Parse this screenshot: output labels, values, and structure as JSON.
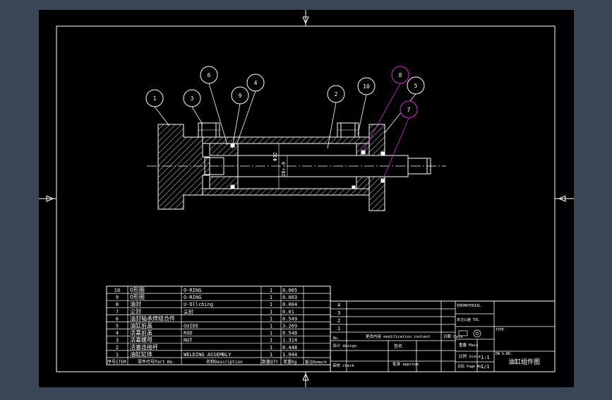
{
  "colors": {
    "background": "#3a4656",
    "sheet": "#000000",
    "line": "#ffffff",
    "balloon_highlight": "#cc33cc"
  },
  "balloons": [
    "1",
    "3",
    "6",
    "9",
    "4",
    "2",
    "10",
    "8",
    "5",
    "7"
  ],
  "dims": {
    "d1": "Φ32",
    "d2": "20↑.0"
  },
  "bom": {
    "rows": [
      {
        "no": "10",
        "name": "O形圈",
        "spec": "O-RING",
        "qty": "1",
        "weight": "0.005"
      },
      {
        "no": "9",
        "name": "O形圈",
        "spec": "O-RING",
        "qty": "1",
        "weight": "0.003"
      },
      {
        "no": "8",
        "name": "油封",
        "spec": "U-Ollching",
        "qty": "1",
        "weight": "0.004"
      },
      {
        "no": "7",
        "name": "尘封",
        "spec": "尘封",
        "qty": "1",
        "weight": "0.01"
      },
      {
        "no": "6",
        "name": "油封轴承焊组合件",
        "spec": "",
        "qty": "1",
        "weight": "0.549"
      },
      {
        "no": "5",
        "name": "油缸前盖",
        "spec": "GUIDE",
        "qty": "1",
        "weight": "3.269"
      },
      {
        "no": "4",
        "name": "活塞前盖",
        "spec": "ROD",
        "qty": "1",
        "weight": "0.548"
      },
      {
        "no": "3",
        "name": "活塞螺母",
        "spec": "NUT",
        "qty": "1",
        "weight": "1.314"
      },
      {
        "no": "2",
        "name": "活塞连接杆",
        "spec": "",
        "qty": "1",
        "weight": "0.448"
      },
      {
        "no": "1",
        "name": "油缸缸体",
        "spec": "WELDING ASSEMBLY",
        "qty": "1",
        "weight": "1.944"
      }
    ],
    "header": {
      "no": "序号ITEM",
      "part": "零件代号Part No.",
      "name": "名称Description",
      "qty": "数量QTY",
      "weight": "单重Kg",
      "note": "备注Remark"
    }
  },
  "revisions": [
    "4",
    "3",
    "2",
    "1"
  ],
  "title_block": {
    "rev_no": "No.",
    "rev_content": "更改内容 modification content",
    "sign": "签名",
    "design": "设计 design",
    "review": "审核 check",
    "approve": "批准 approve",
    "date": "日期 Date",
    "material_label": "材料MATERIAL",
    "tolerance_label": "未注公差 TOL",
    "drawing_no_label": "TYPE",
    "weight_label": "重量 Mass",
    "scale_label": "比例 Scale",
    "scale_value": "1:1",
    "page_label": "页码 Page No.",
    "page_value": "1/1",
    "dwg_code": "DW G.NO.",
    "title": "油缸组件图"
  }
}
